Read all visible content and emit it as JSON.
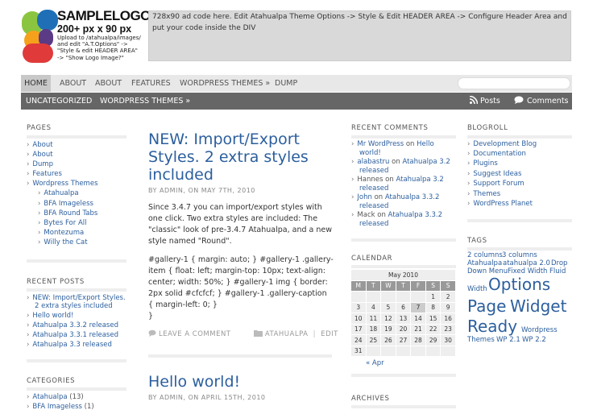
{
  "logo": {
    "title": "SAMPLELOGO",
    "size": "200+ px x 90 px",
    "lines": [
      "Upload to /atahualpa/images/",
      "and edit \"A.T.Options\" ->",
      "\"Style & edit HEADER AREA\"",
      "-> \"Show Logo Image?\""
    ]
  },
  "ad": {
    "text": "728x90 ad code here. Edit Atahualpa Theme Options -> Style & Edit HEADER AREA -> Configure Header Area and put your code inside the DIV"
  },
  "menu1": [
    "HOME",
    "ABOUT",
    "ABOUT",
    "FEATURES",
    "WORDPRESS THEMES",
    "DUMP"
  ],
  "menu2": {
    "items": [
      "UNCATEGORIZED",
      "WORDPRESS THEMES"
    ],
    "posts": "Posts",
    "comments": "Comments"
  },
  "pages": {
    "title": "PAGES",
    "items": [
      "About",
      "About",
      "Dump",
      "Features",
      "Wordpress Themes"
    ],
    "sub": [
      "Atahualpa",
      "BFA Imageless",
      "BFA Round Tabs",
      "Bytes For All",
      "Montezuma",
      "Willy the Cat"
    ]
  },
  "recent_posts": {
    "title": "RECENT POSTS",
    "items": [
      "NEW: Import/Export Styles.",
      "2 extra styles included",
      "Hello world!",
      "Atahualpa 3.3.2 released",
      "Atahualpa 3.3.1 released",
      "Atahualpa 3.3 released"
    ]
  },
  "categories": {
    "title": "CATEGORIES",
    "items": [
      "Atahualpa",
      "BFA Imageless"
    ],
    "counts": [
      "(13)",
      "(1)"
    ]
  },
  "post1": {
    "title_lines": [
      "NEW: Import/Export",
      "Styles. 2 extra styles",
      "included"
    ],
    "meta": "BY ADMIN, ON MAY 7TH, 2010",
    "para": "Since 3.4.7 you can import/export styles with one click. Two extra styles are included: The \"classic\" look of pre-3.4.7 Atahualpa, and a new style named \"Round\".",
    "code": "#gallery-1 { margin: auto; } #gallery-1 .gallery-item { float: left; margin-top: 10px; text-align: center; width: 50%; } #gallery-1 img { border: 2px solid #cfcfcf; } #gallery-1 .gallery-caption { margin-left: 0; }",
    "close": "}",
    "leave": "LEAVE A COMMENT",
    "cat": "ATAHUALPA",
    "sep": "|",
    "edit": "EDIT"
  },
  "post2": {
    "title": "Hello world!",
    "meta": "BY ADMIN, ON APRIL 15TH, 2010"
  },
  "recent_comments": {
    "title": "RECENT COMMENTS",
    "items": [
      {
        "author": "Mr WordPress",
        "on": "on",
        "post": "Hello",
        "post2": "world!"
      },
      {
        "author": "alabastru",
        "on": "on",
        "post": "Atahualpa 3.2",
        "post2": "released"
      },
      {
        "author": "Hannes",
        "on": "on",
        "post": "Atahualpa 3.2",
        "post2": "released"
      },
      {
        "author": "John",
        "on": "on",
        "post": "Atahualpa 3.3.2",
        "post2": "released"
      },
      {
        "author": "Mack",
        "on": "on",
        "post": "Atahualpa 3.3.2",
        "post2": "released"
      }
    ]
  },
  "calendar": {
    "title": "CALENDAR",
    "caption": "May 2010",
    "days": [
      "M",
      "T",
      "W",
      "T",
      "F",
      "S",
      "S"
    ],
    "weeks": [
      [
        "",
        "",
        "",
        "",
        "",
        "1",
        "2"
      ],
      [
        "3",
        "4",
        "5",
        "6",
        "7",
        "8",
        "9"
      ],
      [
        "10",
        "11",
        "12",
        "13",
        "14",
        "15",
        "16"
      ],
      [
        "17",
        "18",
        "19",
        "20",
        "21",
        "22",
        "23"
      ],
      [
        "24",
        "25",
        "26",
        "27",
        "28",
        "29",
        "30"
      ],
      [
        "31",
        "",
        "",
        "",
        "",
        "",
        ""
      ]
    ],
    "prev": "« Apr",
    "highlight": "7"
  },
  "archives": {
    "title": "ARCHIVES"
  },
  "blogroll": {
    "title": "BLOGROLL",
    "items": [
      "Development Blog",
      "Documentation",
      "Plugins",
      "Suggest Ideas",
      "Support Forum",
      "Themes",
      "WordPress Planet"
    ]
  },
  "tags": {
    "title": "TAGS"
  },
  "colors": {
    "link": "#2c5f9e",
    "menu_dark": "#666666",
    "menu_light": "#e8e8e8",
    "ad_bg": "#d9d9d9"
  }
}
